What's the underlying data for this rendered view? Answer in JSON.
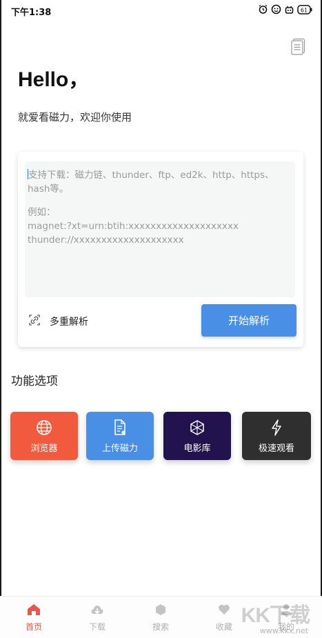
{
  "status_bar": {
    "time": "下午1:38",
    "battery": "61"
  },
  "header": {
    "greeting": "Hello，",
    "welcome": "就爱看磁力，欢迎你使用"
  },
  "parser": {
    "placeholder_line1": "支持下载：磁力链、thunder、ftp、ed2k、http、https、",
    "placeholder_line2": "hash等。",
    "example_label": "例如：",
    "example_magnet": "magnet:?xt=urn:btih:xxxxxxxxxxxxxxxxxxxx",
    "example_thunder": "thunder://xxxxxxxxxxxxxxxxxxxx",
    "multi_parse_label": "多重解析",
    "start_button_label": "开始解析"
  },
  "features": {
    "title": "功能选项",
    "items": [
      {
        "label": "浏览器",
        "icon": "globe-icon",
        "color": "#f25a3e"
      },
      {
        "label": "上传磁力",
        "icon": "upload-doc-icon",
        "color": "#4a8fe6"
      },
      {
        "label": "电影库",
        "icon": "cube-icon",
        "color": "#22134f"
      },
      {
        "label": "极速观看",
        "icon": "lightning-icon",
        "color": "#2f2f2f"
      }
    ]
  },
  "bottom_nav": {
    "items": [
      {
        "label": "首页",
        "icon": "home-icon",
        "active": true
      },
      {
        "label": "下载",
        "icon": "download-icon",
        "active": false
      },
      {
        "label": "搜索",
        "icon": "search-hex-icon",
        "active": false
      },
      {
        "label": "收藏",
        "icon": "heart-icon",
        "active": false
      },
      {
        "label": "我的",
        "icon": "user-icon",
        "active": false
      }
    ]
  },
  "watermark": {
    "logo": "KK下载",
    "url": "www.kkx.net"
  },
  "colors": {
    "accent": "#4a8fe6",
    "active_nav": "#e8584a"
  }
}
